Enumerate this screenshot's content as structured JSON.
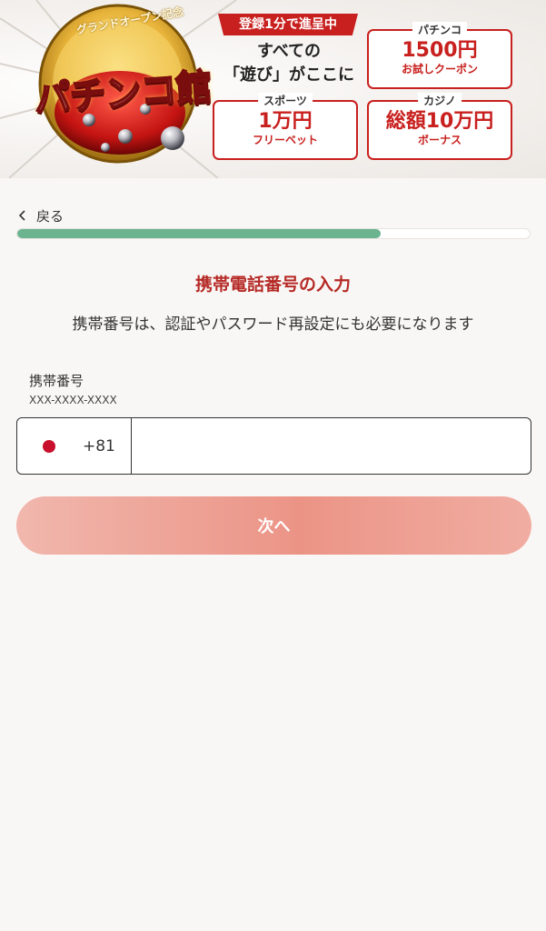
{
  "banner": {
    "logo_arc_text": "グランドオープン記念",
    "logo_title": "パチンコ館",
    "catch_tag": "登録1分で進呈中",
    "catch_line1": "すべての",
    "catch_line2": "「遊び」がここに",
    "offers": [
      {
        "category": "パチンコ",
        "main": "1500円",
        "sub": "お試しクーポン"
      },
      {
        "category": "スポーツ",
        "main": "1万円",
        "sub": "フリーベット"
      },
      {
        "category": "カジノ",
        "main": "総額10万円",
        "sub": "ボーナス"
      }
    ]
  },
  "nav": {
    "back_label": "戻る"
  },
  "progress": {
    "fraction": 0.71
  },
  "form": {
    "title": "携帯電話番号の入力",
    "description": "携帯番号は、認証やパスワード再設定にも必要になります",
    "phone_label": "携帯番号",
    "phone_hint": "XXX-XXXX-XXXX",
    "dial_code": "+81",
    "phone_value": "",
    "next_label": "次へ"
  },
  "colors": {
    "accent": "#b52a26",
    "progress": "#6cb390",
    "button": "#eb9486"
  }
}
